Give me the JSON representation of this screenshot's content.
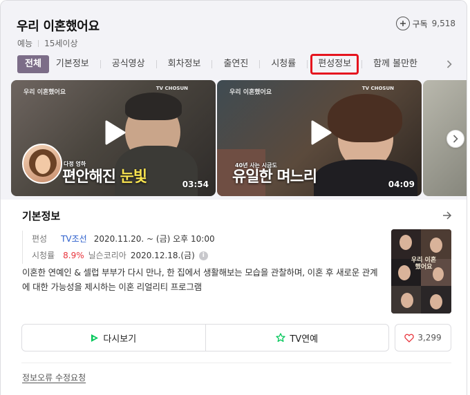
{
  "header": {
    "title": "우리 이혼했어요",
    "genre": "예능",
    "rating_age": "15세이상",
    "subscribe_label": "구독",
    "subscribe_count": "9,518"
  },
  "tabs": [
    {
      "label": "전체",
      "active": true
    },
    {
      "label": "기본정보"
    },
    {
      "label": "공식영상"
    },
    {
      "label": "회차정보"
    },
    {
      "label": "출연진"
    },
    {
      "label": "시청률"
    },
    {
      "label": "편성정보",
      "highlighted": true
    },
    {
      "label": "함께 볼만한"
    }
  ],
  "videos": [
    {
      "duration": "03:54",
      "caption": "편안해진",
      "caption_highlight": "눈빛",
      "small_caption": "다정 엉하",
      "tv_logo": "TV CHOSUN"
    },
    {
      "duration": "04:09",
      "caption": "유일한 며느리",
      "small_caption": "40년 사는 시금도",
      "tv_logo": "TV CHOSUN"
    }
  ],
  "basic_info": {
    "section_title": "기본정보",
    "broadcast_label": "편성",
    "channel": "TV조선",
    "schedule": "2020.11.20. ~ (금) 오후 10:00",
    "viewership_label": "시청률",
    "viewership_value": "8.9%",
    "viewership_source": "닐슨코리아",
    "viewership_date": "2020.12.18.(금)",
    "info_icon_glyph": "i",
    "description": "이혼한 연예인 & 셀럽 부부가 다시 만나, 한 집에서 생활해보는 모습을 관찰하며, 이혼 후 새로운 관계에 대한 가능성을 제시하는 이혼 리얼리티 프로그램",
    "poster_title": "우리 이혼했어요"
  },
  "actions": {
    "replay_label": "다시보기",
    "tv_entertainment_label": "TV연예",
    "like_count": "3,299"
  },
  "footer": {
    "report_label": "정보오류 수정요청"
  },
  "colors": {
    "active_tab_bg": "#7c6d88",
    "highlight_outline": "#e5141e",
    "link_blue": "#2b5ecc",
    "rating_red": "#e8333b",
    "replay_green": "#03c75a",
    "heart_red": "#e8333b"
  },
  "icons": [
    "plus-icon",
    "chevron-right-icon",
    "play-icon",
    "arrow-right-icon",
    "info-icon",
    "play-triangle-icon",
    "star-icon",
    "heart-icon"
  ]
}
